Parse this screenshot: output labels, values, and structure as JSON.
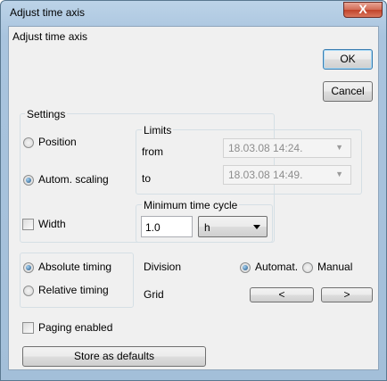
{
  "window": {
    "title": "Adjust time axis",
    "close_glyph": "X"
  },
  "dialog": {
    "heading": "Adjust time axis",
    "ok_label": "OK",
    "cancel_label": "Cancel"
  },
  "settings": {
    "group_label": "Settings",
    "position_label": "Position",
    "autoscaling_label": "Autom. scaling",
    "width_label": "Width",
    "selected": "Autom. scaling",
    "width_checked": false
  },
  "limits": {
    "group_label": "Limits",
    "from_label": "from",
    "from_value": "18.03.08  14:24.",
    "to_label": "to",
    "to_value": "18.03.08  14:49."
  },
  "min_cycle": {
    "group_label": "Minimum time cycle",
    "value": "1.0",
    "unit": "h"
  },
  "timing": {
    "absolute_label": "Absolute timing",
    "relative_label": "Relative timing",
    "selected": "Absolute timing"
  },
  "division": {
    "label": "Division",
    "automat_label": "Automat.",
    "manual_label": "Manual",
    "selected": "Automat."
  },
  "grid": {
    "label": "Grid",
    "left_label": "<",
    "right_label": ">"
  },
  "paging": {
    "label": "Paging enabled",
    "checked": false
  },
  "store_defaults_label": "Store as defaults"
}
